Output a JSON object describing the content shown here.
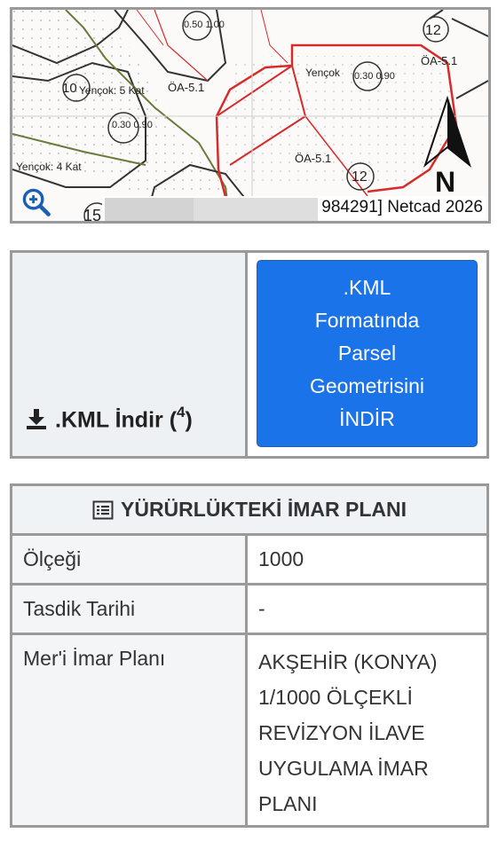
{
  "map": {
    "labels": {
      "yencok_5kat": "Yençok: 5 Kat",
      "yencok_4kat": "Yençok: 4 Kat",
      "yencok": "Yençok",
      "n10": "10",
      "n12_top": "12",
      "n12_bottom": "12",
      "n15": "15",
      "oa51_top": "ÖA-5.1",
      "oa51_left": "ÖA-5.1",
      "oa51_mid": "ÖA-5.1",
      "ratio_top": "0.50 1.00",
      "ratio_left": "0.30 0.90",
      "ratio_right": "0.30 0.90",
      "compass_n": "N"
    },
    "footer_text": "984291] Netcad 2026",
    "zoom_icon": "zoom-in-icon"
  },
  "kml": {
    "download_label": ".KML İndir (",
    "download_sup": "4",
    "download_close": ")",
    "download_icon": "download-icon",
    "button_lines": [
      ".KML",
      "Formatında",
      "Parsel",
      "Geometrisini",
      "İNDİR"
    ]
  },
  "plan": {
    "title": "YÜRÜRLÜKTEKİ İMAR PLANI",
    "title_icon": "list-icon",
    "rows": [
      {
        "label": "Ölçeği",
        "value": "1000"
      },
      {
        "label": "Tasdik Tarihi",
        "value": "-"
      },
      {
        "label": "Mer'i İmar Planı",
        "value_lines": [
          "AKŞEHİR (KONYA)",
          "1/1000 ÖLÇEKLİ",
          "REVİZYON İLAVE",
          "UYGULAMA İMAR",
          "PLANI"
        ]
      }
    ]
  },
  "colors": {
    "button_blue": "#1a73e8",
    "parcel_red": "#d62b2b",
    "border_gray": "#9a9a9a"
  }
}
